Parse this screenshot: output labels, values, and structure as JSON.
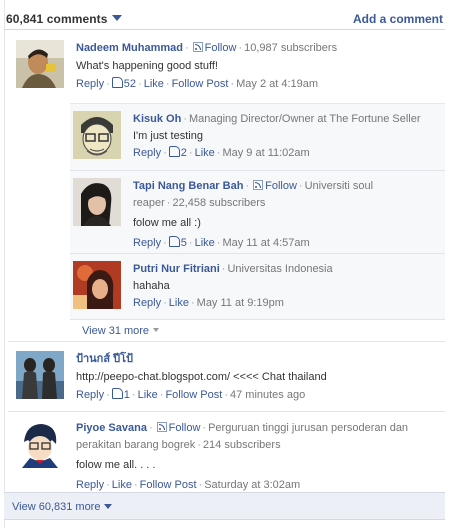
{
  "header": {
    "count": "60,841 comments",
    "add_comment": "Add a comment"
  },
  "colors": {
    "link": "#3b5998",
    "muted": "#777777",
    "footer_bg": "#eceff5"
  },
  "comments": [
    {
      "name": "Nadeem Muhammad",
      "follow": "Follow",
      "subscribers": "10,987 subscribers",
      "text": "What's happening good stuff!",
      "reply": "Reply",
      "likes": "52",
      "like": "Like",
      "follow_post": "Follow Post",
      "time": "May 2 at 4:19am",
      "avatar_icon": "avatar-photo",
      "replies": [
        {
          "name": "Kisuk Oh",
          "title": "Managing Director/Owner at The Fortune Seller",
          "text": "I'm just testing",
          "reply": "Reply",
          "likes": "2",
          "like": "Like",
          "time": "May 9 at 11:02am"
        },
        {
          "name": "Tapi Nang Benar Bah",
          "follow": "Follow",
          "title": "Universiti soul reaper",
          "subscribers": "22,458 subscribers",
          "text": "folow me all :)",
          "reply": "Reply",
          "likes": "5",
          "like": "Like",
          "time": "May 11 at 4:57am"
        },
        {
          "name": "Putri Nur Fitriani",
          "title": "Universitas Indonesia",
          "text": "hahaha",
          "reply": "Reply",
          "like": "Like",
          "time": "May 11 at 9:19pm"
        }
      ],
      "view_more": "View 31 more"
    },
    {
      "name": "ป้านกส์ ปีโป้",
      "text": "http://peepo-chat.blogspot.com/ <<<< Chat thailand",
      "reply": "Reply",
      "likes": "1",
      "like": "Like",
      "follow_post": "Follow Post",
      "time": "47 minutes ago"
    },
    {
      "name": "Piyoe Savana",
      "follow": "Follow",
      "title": "Perguruan tinggi jurusan persoderan dan perakitan barang bogrek",
      "subscribers": "214 subscribers",
      "text": "folow me all. . . .",
      "reply": "Reply",
      "like": "Like",
      "follow_post": "Follow Post",
      "time": "Saturday at 3:02am"
    }
  ],
  "footer": {
    "view_more": "View 60,831 more"
  }
}
